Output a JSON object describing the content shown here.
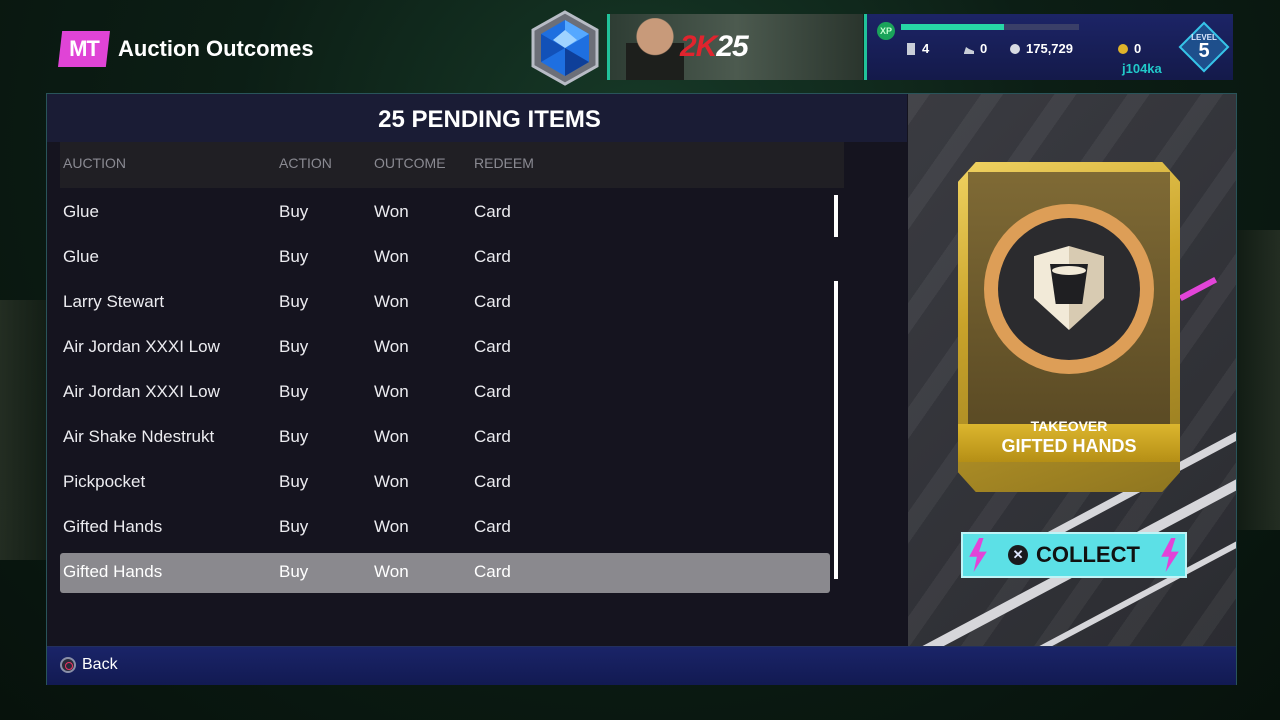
{
  "header": {
    "badge": "MT",
    "title": "Auction Outcomes",
    "banner_logo_prefix": "2K",
    "banner_logo_suffix": "25"
  },
  "stats": {
    "xp_label": "XP",
    "xp_progress": 0.58,
    "cards_count": "4",
    "shoe_count": "0",
    "vc": "175,729",
    "mt_coins": "0",
    "username": "j104ka",
    "level_label": "LEVEL",
    "level": "5"
  },
  "list": {
    "title": "25 PENDING ITEMS",
    "columns": [
      "AUCTION",
      "ACTION",
      "OUTCOME",
      "REDEEM"
    ],
    "rows": [
      [
        "Glue",
        "Buy",
        "Won",
        "Card"
      ],
      [
        "Glue",
        "Buy",
        "Won",
        "Card"
      ],
      [
        "Larry Stewart",
        "Buy",
        "Won",
        "Card"
      ],
      [
        "Air Jordan XXXI Low",
        "Buy",
        "Won",
        "Card"
      ],
      [
        "Air Jordan XXXI Low",
        "Buy",
        "Won",
        "Card"
      ],
      [
        "Air Shake Ndestrukt",
        "Buy",
        "Won",
        "Card"
      ],
      [
        "Pickpocket",
        "Buy",
        "Won",
        "Card"
      ],
      [
        "Gifted Hands",
        "Buy",
        "Won",
        "Card"
      ],
      [
        "Gifted Hands",
        "Buy",
        "Won",
        "Card"
      ]
    ],
    "selected_index": 8
  },
  "preview": {
    "card_type": "TAKEOVER",
    "card_name": "GIFTED HANDS",
    "collect_label": "COLLECT"
  },
  "footer": {
    "back_label": "Back"
  },
  "colors": {
    "accent_teal": "#21c29a",
    "mt_pink": "#e044d6",
    "collect_cyan": "#5ce0e6"
  }
}
